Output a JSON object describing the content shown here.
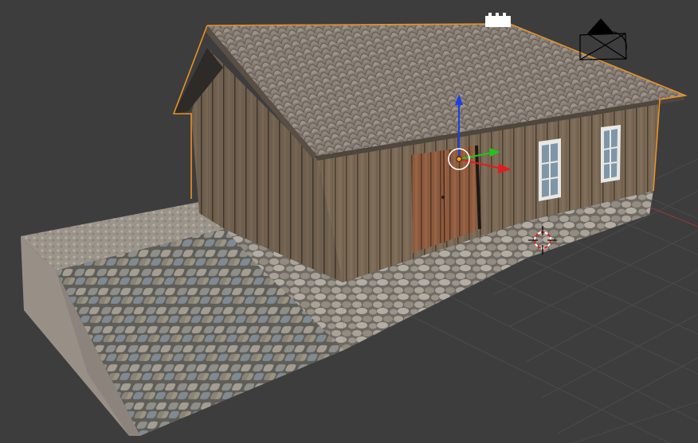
{
  "app": {
    "name": "3D viewport",
    "view": "perspective"
  },
  "viewport": {
    "background": "#3d3d3d",
    "grid_color": "#4a4a4a",
    "x_axis_color": "#8a3b3b",
    "selection_outline_color": "#e8922a"
  },
  "object": {
    "kind": "farmhouse-with-cobblestone-ramp",
    "selected": true
  },
  "gizmo": {
    "x_color": "#e11d1d",
    "y_color": "#22c31b",
    "z_color": "#1c3ee8",
    "origin_color": "#f0a020"
  },
  "cursor_3d": {
    "icon": "3d-cursor-icon"
  },
  "camera": {
    "icon": "camera-icon"
  },
  "lamp": {
    "icon": "lamp-icon"
  }
}
